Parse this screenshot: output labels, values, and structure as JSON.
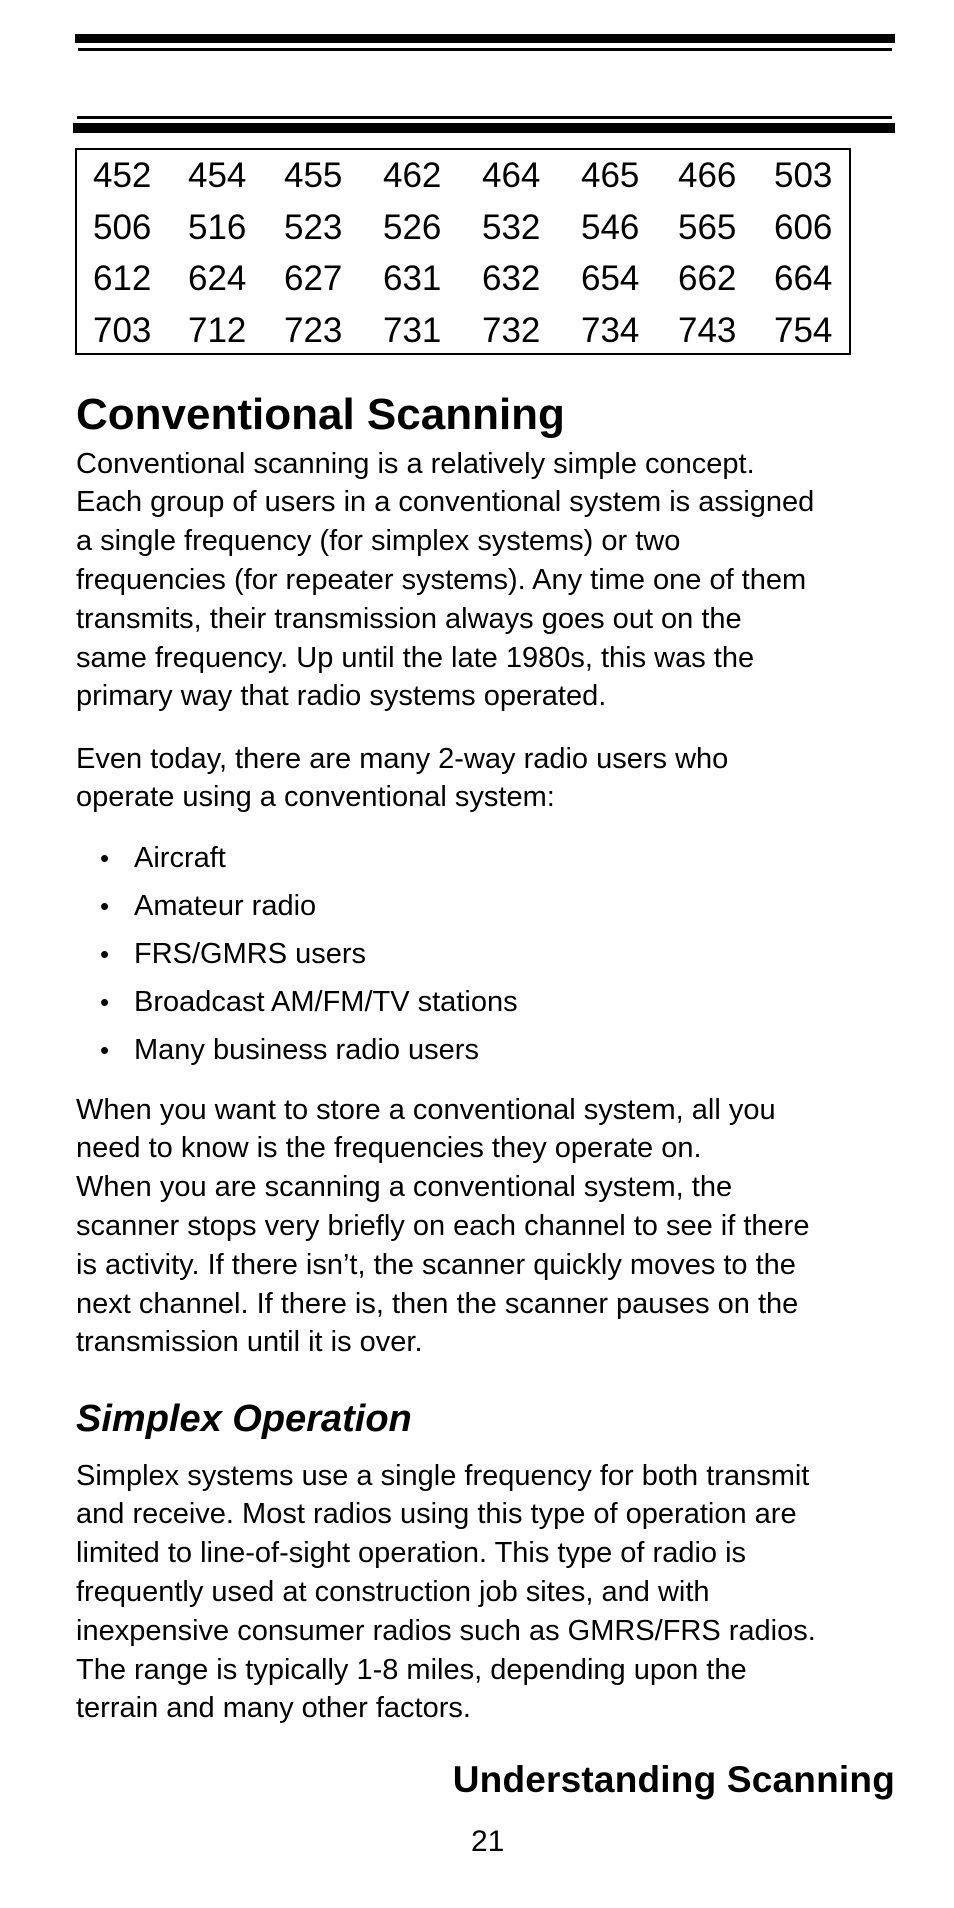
{
  "code_table": {
    "rows": [
      [
        "452",
        "454",
        "455",
        "462",
        "464",
        "465",
        "466",
        "503"
      ],
      [
        "506",
        "516",
        "523",
        "526",
        "532",
        "546",
        "565",
        "606"
      ],
      [
        "612",
        "624",
        "627",
        "631",
        "632",
        "654",
        "662",
        "664"
      ],
      [
        "703",
        "712",
        "723",
        "731",
        "732",
        "734",
        "743",
        "754"
      ]
    ]
  },
  "section": {
    "heading": "Conventional Scanning",
    "para1": [
      "Conventional scanning is a relatively simple concept.",
      "Each group of users in a conventional system is assigned",
      "a single frequency (for simplex systems) or two",
      "frequencies (for repeater systems). Any time one of them",
      "transmits, their transmission always goes out on the",
      "same frequency. Up until the late 1980s, this was the",
      "primary way that radio systems operated."
    ],
    "para2": [
      "Even today, there are many 2-way radio users who",
      "operate using a conventional system:"
    ],
    "bullet_char": "•",
    "bullets": [
      "Aircraft",
      "Amateur radio",
      "FRS/GMRS users",
      "Broadcast AM/FM/TV stations",
      "Many business radio users"
    ],
    "para3": [
      "When you want to store a conventional system, all you",
      "need to know is the frequencies they operate on.",
      "When you are scanning a conventional system, the",
      "scanner stops very briefly on each channel to see if there",
      "is activity. If there isn’t, the scanner quickly moves to the",
      "next channel. If there is, then the scanner pauses on the",
      "transmission until it is over."
    ]
  },
  "subsection": {
    "heading": "Simplex Operation",
    "para": [
      "Simplex systems use a single frequency for both transmit",
      "and receive. Most radios using this type of operation are",
      "limited to line-of-sight operation. This type of radio is",
      "frequently used at construction job sites, and with",
      "inexpensive consumer radios such as GMRS/FRS radios.",
      "The range is typically 1-8 miles, depending upon the",
      "terrain and many other factors."
    ]
  },
  "footer": {
    "chapter_title": "Understanding Scanning",
    "page_number": "21"
  }
}
